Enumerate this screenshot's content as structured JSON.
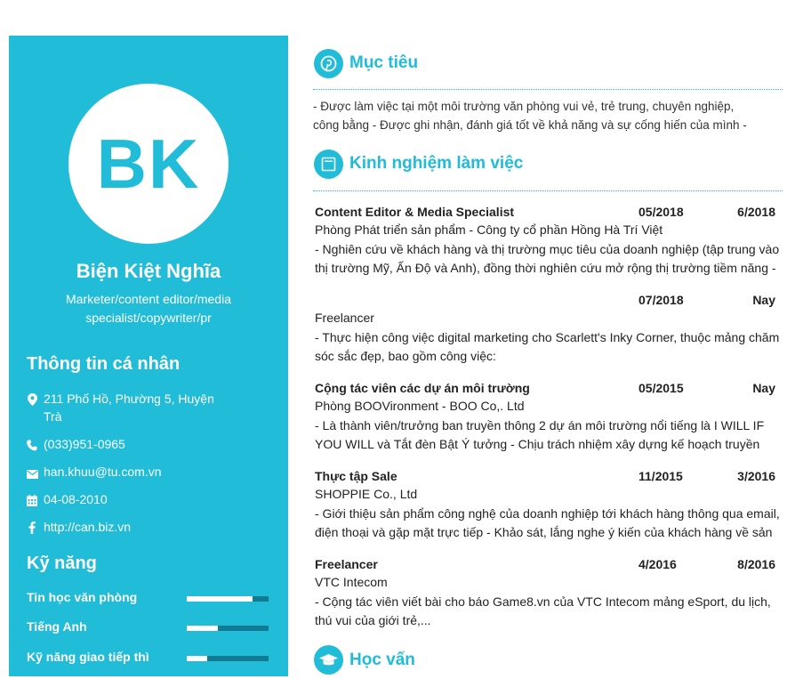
{
  "profile": {
    "initials": "BK",
    "name": "Biện Kiệt Nghĩa",
    "role": "Marketer/content editor/media specialist/copywriter/pr"
  },
  "personal_info": {
    "heading": "Thông tin cá nhân",
    "address": "211 Phố Hồ, Phường 5, Huyện Trà",
    "phone": "(033)951-0965",
    "email": "han.khuu@tu.com.vn",
    "birthday": "04-08-2010",
    "website": "http://can.biz.vn"
  },
  "skills": {
    "heading": "Kỹ năng",
    "items": [
      {
        "label": "Tin học văn phòng",
        "level": 0.8
      },
      {
        "label": "Tiếng Anh",
        "level": 0.38
      },
      {
        "label": "Kỹ năng giao tiếp thì",
        "level": 0.25
      }
    ]
  },
  "objective": {
    "title": "Mục tiêu",
    "lines": [
      "- Được làm việc tại một môi trường văn phòng vui vẻ, trẻ trung, chuyên nghiệp,",
      "công bằng - Được ghi nhận, đánh giá tốt về khả năng và sự cống hiến của mình  -"
    ]
  },
  "experience": {
    "title": "Kinh nghiệm làm việc",
    "jobs": [
      {
        "title": "Content Editor & Media Specialist",
        "start": "05/2018",
        "end": "6/2018",
        "company": "Phòng Phát triển sản phẩm - Công ty cổ phần Hồng Hà Trí Việt",
        "desc": "- Nghiên cứu về khách hàng và thị trường mục tiêu của doanh nghiệp (tập trung vào thị trường Mỹ, Ấn Độ và Anh), đồng thời nghiên cứu mở rộng thị trường tiềm năng -"
      },
      {
        "title": "",
        "start": "07/2018",
        "end": "Nay",
        "company": "Freelancer",
        "desc": "- Thực hiện công việc digital marketing cho Scarlett's Inky Corner, thuộc mảng chăm sóc sắc đẹp, bao gồm công việc:"
      },
      {
        "title": "Cộng tác viên các dự án môi trường",
        "start": "05/2015",
        "end": "Nay",
        "company": "Phòng BOOVironment - BOO Co,. Ltd",
        "desc": "- Là thành viên/trưởng ban truyền thông 2 dự án môi trường nổi tiếng là I WILL IF YOU WILL và Tắt đèn Bật Ý tưởng - Chịu trách nhiệm xây dựng kế hoạch truyền"
      },
      {
        "title": "Thực tập Sale",
        "start": "11/2015",
        "end": "3/2016",
        "company": "SHOPPIE Co., Ltd",
        "desc": "- Giới thiệu sản phẩm công nghệ của doanh nghiệp tới khách hàng thông qua email, điện thoại và gặp mặt trực tiếp - Khảo sát, lắng nghe ý kiến của khách hàng về sản"
      },
      {
        "title": "Freelancer",
        "start": "4/2016",
        "end": "8/2016",
        "company": "VTC Intecom",
        "desc": "- Cộng tác viên viết bài cho báo Game8.vn của VTC Intecom mảng eSport, du lịch, thú vui của giới trẻ,..."
      }
    ]
  },
  "education": {
    "title": "Học vấn"
  },
  "colors": {
    "accent": "#20bcd8",
    "skill_track": "#127a92"
  },
  "icons": {
    "objective": "pinterest-icon",
    "experience": "briefcase-icon",
    "education": "graduation-cap-icon",
    "address": "map-pin-icon",
    "phone": "phone-icon",
    "email": "envelope-icon",
    "birthday": "calendar-icon",
    "website": "facebook-icon"
  }
}
